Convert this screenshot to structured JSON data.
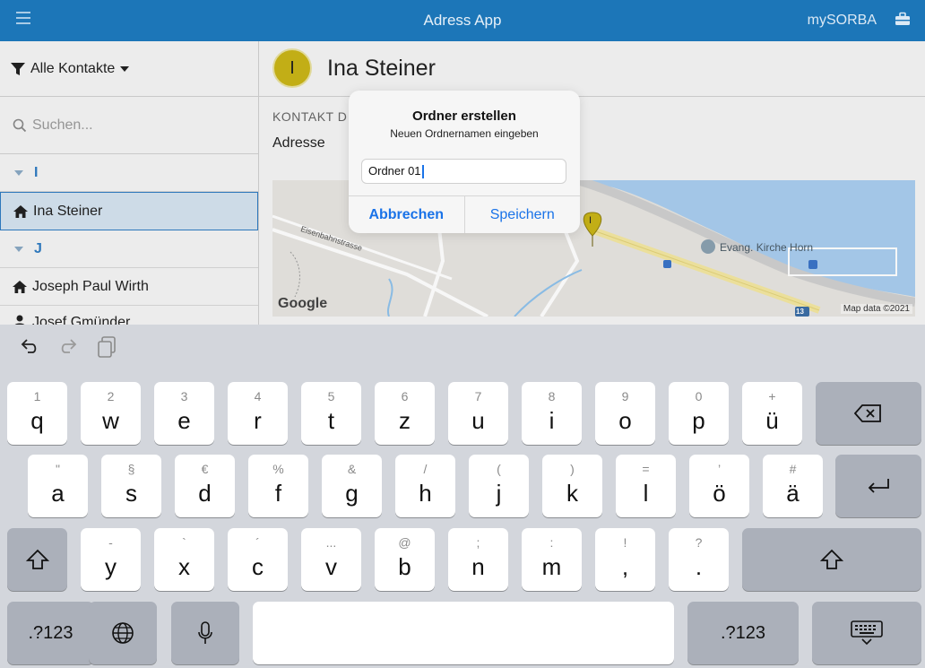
{
  "app": {
    "title": "Adress App",
    "brand": "mySORBA"
  },
  "sidebar": {
    "filter_label": "Alle Kontakte",
    "search_placeholder": "Suchen...",
    "group_i": "I",
    "group_j": "J",
    "items": [
      {
        "label": "Ina Steiner",
        "selected": true
      },
      {
        "label": "Joseph Paul Wirth",
        "selected": false
      },
      {
        "label": "Josef Gmünder",
        "selected": false
      }
    ]
  },
  "detail": {
    "avatar_initial": "I",
    "name": "Ina Steiner",
    "section_label": "KONTAKT D",
    "address_label": "Adresse",
    "map": {
      "street_label": "Eisenbahnstrasse",
      "church_label": "Evang. Kirche Horn",
      "route_number": "13",
      "attribution": "Map data ©2021",
      "logo": "Google",
      "pin_letter": "I"
    }
  },
  "dialog": {
    "title": "Ordner erstellen",
    "subtitle": "Neuen Ordnernamen eingeben",
    "input_value": "Ordner 01",
    "cancel_label": "Abbrechen",
    "save_label": "Speichern"
  },
  "keyboard": {
    "row1": [
      {
        "hint": "1",
        "key": "q"
      },
      {
        "hint": "2",
        "key": "w"
      },
      {
        "hint": "3",
        "key": "e"
      },
      {
        "hint": "4",
        "key": "r"
      },
      {
        "hint": "5",
        "key": "t"
      },
      {
        "hint": "6",
        "key": "z"
      },
      {
        "hint": "7",
        "key": "u"
      },
      {
        "hint": "8",
        "key": "i"
      },
      {
        "hint": "9",
        "key": "o"
      },
      {
        "hint": "0",
        "key": "p"
      },
      {
        "hint": "+",
        "key": "ü"
      }
    ],
    "row2": [
      {
        "hint": "\"",
        "key": "a"
      },
      {
        "hint": "§",
        "key": "s"
      },
      {
        "hint": "€",
        "key": "d"
      },
      {
        "hint": "%",
        "key": "f"
      },
      {
        "hint": "&",
        "key": "g"
      },
      {
        "hint": "/",
        "key": "h"
      },
      {
        "hint": "(",
        "key": "j"
      },
      {
        "hint": ")",
        "key": "k"
      },
      {
        "hint": "=",
        "key": "l"
      },
      {
        "hint": "’",
        "key": "ö"
      },
      {
        "hint": "#",
        "key": "ä"
      }
    ],
    "row3": [
      {
        "hint": "-",
        "key": "y"
      },
      {
        "hint": "`",
        "key": "x"
      },
      {
        "hint": "´",
        "key": "c"
      },
      {
        "hint": "...",
        "key": "v"
      },
      {
        "hint": "@",
        "key": "b"
      },
      {
        "hint": ";",
        "key": "n"
      },
      {
        "hint": ":",
        "key": "m"
      },
      {
        "hint": "!",
        "key": ","
      },
      {
        "hint": "?",
        "key": "."
      }
    ],
    "numbers_label": ".?123"
  }
}
